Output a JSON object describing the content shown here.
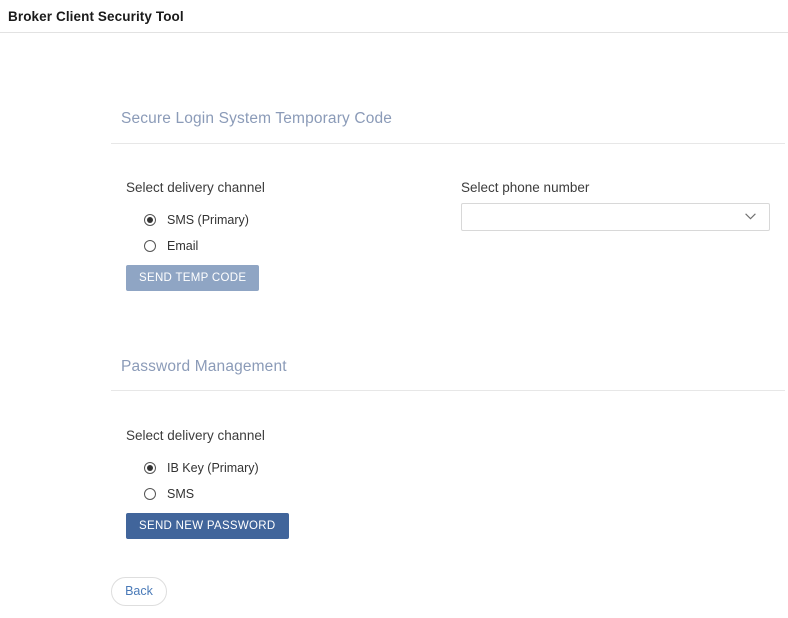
{
  "header": {
    "title": "Broker Client Security Tool"
  },
  "sections": [
    {
      "id": "secure-login",
      "heading": "Secure Login System Temporary Code",
      "channel_label": "Select delivery channel",
      "options": [
        {
          "label": "SMS (Primary)",
          "selected": true
        },
        {
          "label": "Email",
          "selected": false
        }
      ],
      "submit_label": "SEND TEMP CODE",
      "phone_label": "Select phone number",
      "phone_value": "",
      "phone_placeholder": "",
      "chevron_icon": "chevron-down-icon"
    },
    {
      "id": "password-management",
      "heading": "Password Management",
      "channel_label": "Select delivery channel",
      "options": [
        {
          "label": "IB Key (Primary)",
          "selected": true
        },
        {
          "label": "SMS",
          "selected": false
        }
      ],
      "submit_label": "SEND NEW PASSWORD"
    }
  ],
  "footer": {
    "back_label": "Back"
  },
  "colors": {
    "heading": "#8b9bb8",
    "button_muted": "#8fa5c4",
    "button_primary": "#41659b",
    "back_text": "#4a7ab8",
    "rule": "#e7e7e7"
  }
}
